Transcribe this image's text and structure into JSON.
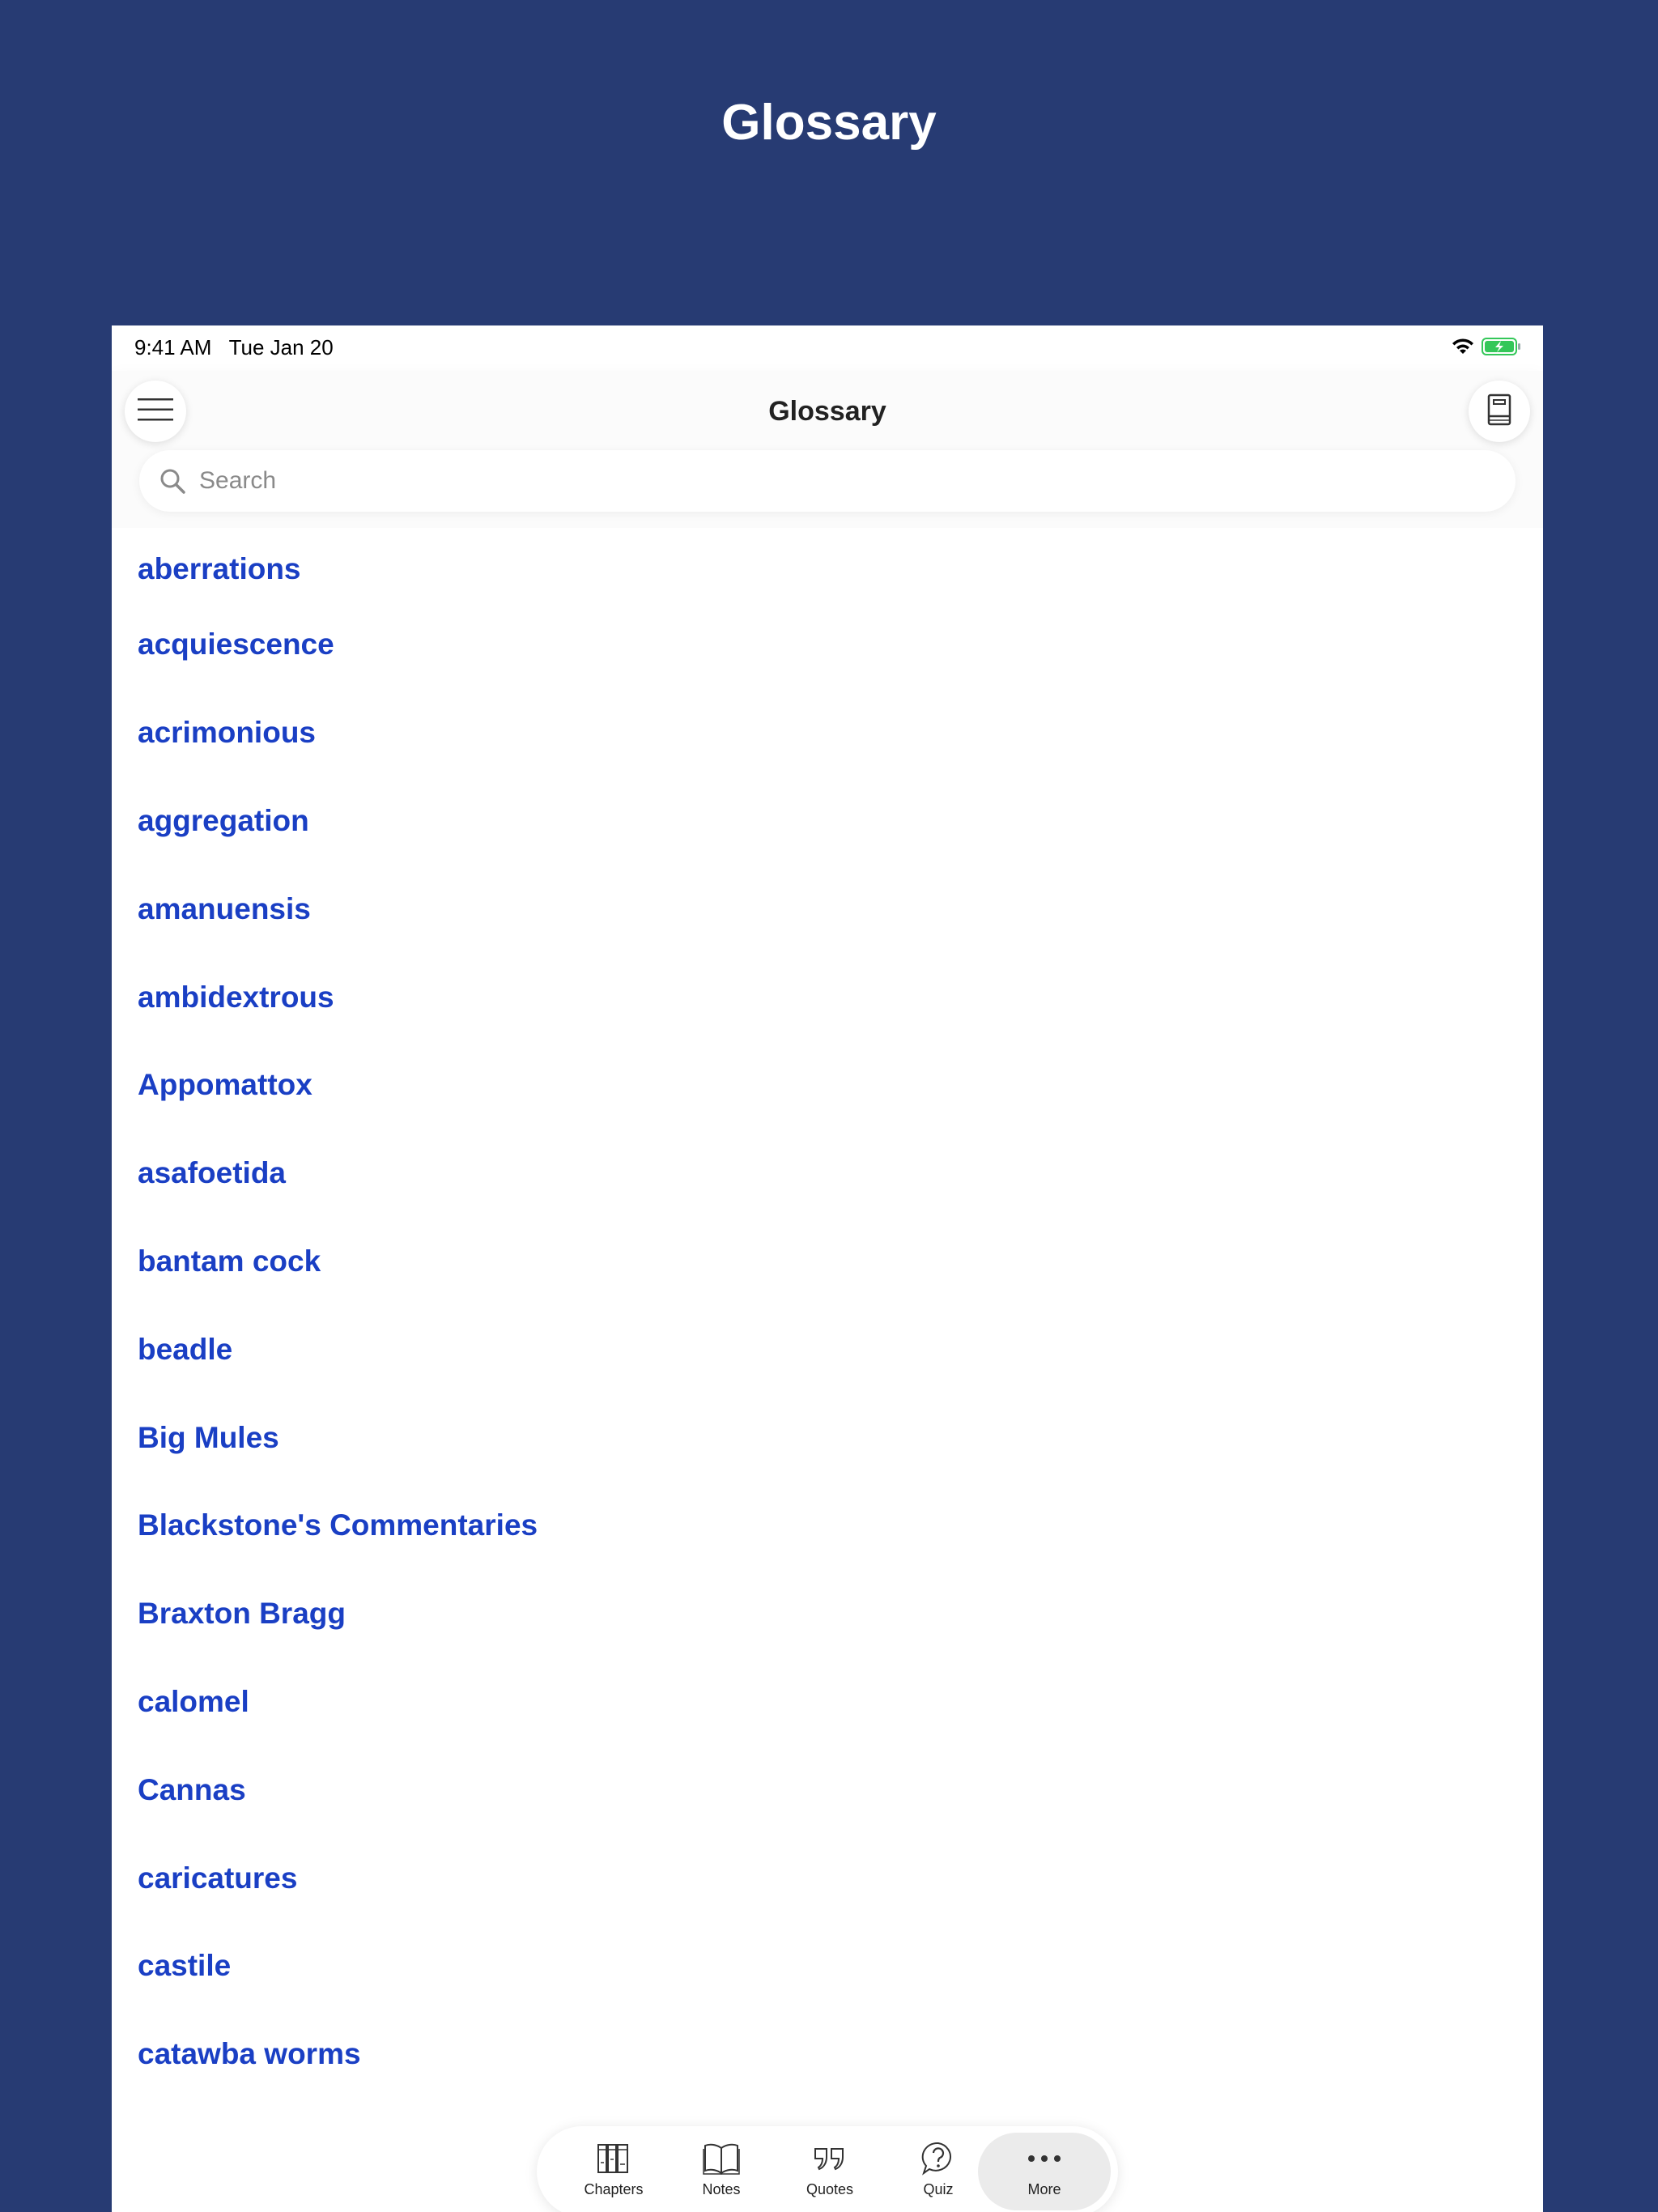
{
  "promo": {
    "title": "Glossary"
  },
  "status_bar": {
    "time": "9:41 AM   Tue Jan 20"
  },
  "header": {
    "title": "Glossary"
  },
  "search": {
    "placeholder": "Search"
  },
  "glossary": {
    "items": [
      "aberrations",
      "acquiescence",
      "acrimonious",
      "aggregation",
      "amanuensis",
      "ambidextrous",
      "Appomattox",
      "asafoetida",
      "bantam cock",
      "beadle",
      "Big Mules",
      "Blackstone's Commentaries",
      "Braxton Bragg",
      "calomel",
      "Cannas",
      "caricatures",
      "castile",
      "catawba worms"
    ]
  },
  "tab_bar": {
    "tabs": [
      {
        "label": "Chapters",
        "icon": "chapters-icon"
      },
      {
        "label": "Notes",
        "icon": "open-book-icon"
      },
      {
        "label": "Quotes",
        "icon": "quotes-icon"
      },
      {
        "label": "Quiz",
        "icon": "question-bubble-icon"
      },
      {
        "label": "More",
        "icon": "more-dots-icon"
      }
    ],
    "active": "More"
  },
  "colors": {
    "background": "#273b73",
    "link": "#1a3fc4",
    "battery": "#34c759"
  }
}
